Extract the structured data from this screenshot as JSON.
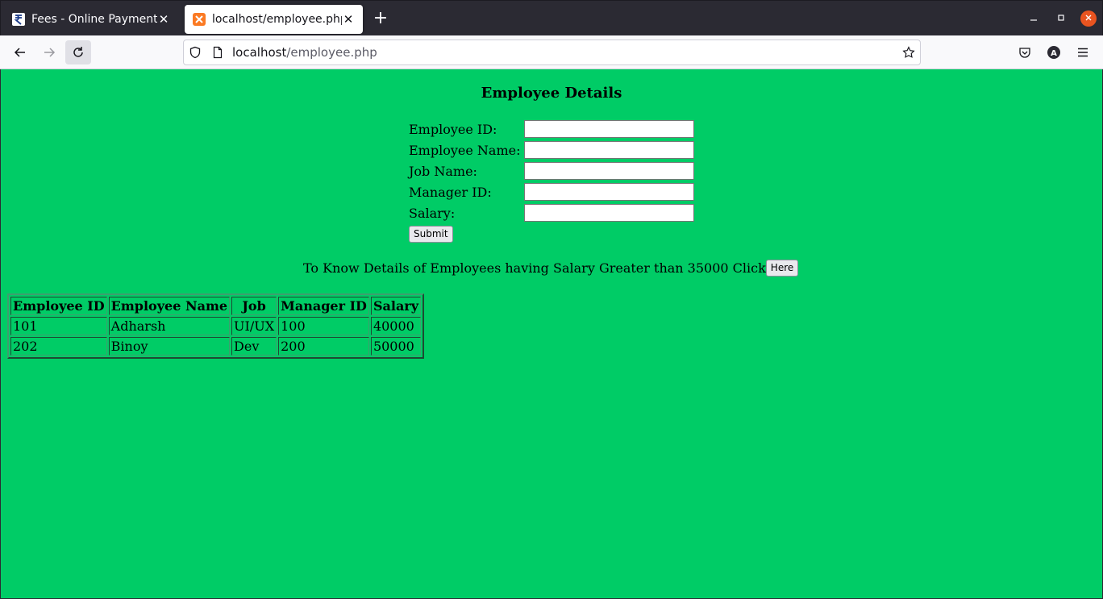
{
  "browser": {
    "tabs": [
      {
        "title": "Fees - Online Payment",
        "favicon": "rupee-icon",
        "active": false
      },
      {
        "title": "localhost/employee.php",
        "favicon": "xampp-icon",
        "active": true
      }
    ],
    "new_tab": "+",
    "url": {
      "host": "localhost",
      "path": "/employee.php"
    }
  },
  "page": {
    "background": "#00cc66",
    "title": "Employee Details",
    "form": {
      "fields": [
        {
          "label": "Employee ID:",
          "value": ""
        },
        {
          "label": "Employee Name:",
          "value": ""
        },
        {
          "label": "Job Name:",
          "value": ""
        },
        {
          "label": "Manager ID:",
          "value": ""
        },
        {
          "label": "Salary:",
          "value": ""
        }
      ],
      "submit_label": "Submit"
    },
    "info_text": "To Know Details of Employees having Salary Greater than 35000 Click",
    "here_label": "Here",
    "table": {
      "headers": [
        "Employee ID",
        "Employee Name",
        "Job",
        "Manager ID",
        "Salary"
      ],
      "rows": [
        [
          "101",
          "Adharsh",
          "UI/UX",
          "100",
          "40000"
        ],
        [
          "202",
          "Binoy",
          "Dev",
          "200",
          "50000"
        ]
      ]
    }
  }
}
